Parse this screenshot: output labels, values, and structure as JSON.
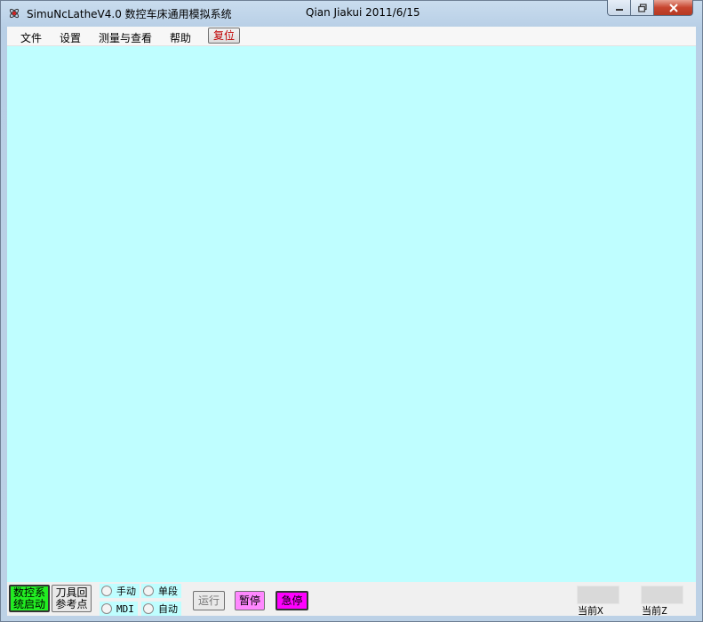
{
  "window": {
    "title": "SimuNcLatheV4.0  数控车床通用模拟系统",
    "author": "Qian Jiakui 2011/6/15",
    "app_icon": "atom-icon",
    "controls": [
      "minimize-icon",
      "maximize-icon",
      "close-icon"
    ]
  },
  "menu": {
    "items": [
      "文件",
      "设置",
      "测量与查看",
      "帮助"
    ],
    "reset_label": "复位",
    "reset_color": "#c00000"
  },
  "canvas": {
    "background": "#bffeff"
  },
  "controls": {
    "start_label": "数控系\n统启动",
    "tool_label": "刀具回\n参考点",
    "modes": [
      "手动",
      "单段",
      "MDI",
      "自动"
    ],
    "run_label": "运行",
    "pause_label": "暂停",
    "estop_label": "急停",
    "start_color": "#22ee22",
    "pause_color": "#ff88ff",
    "estop_color": "#ff00ff"
  },
  "coords": {
    "x_label": "当前X",
    "z_label": "当前Z"
  }
}
